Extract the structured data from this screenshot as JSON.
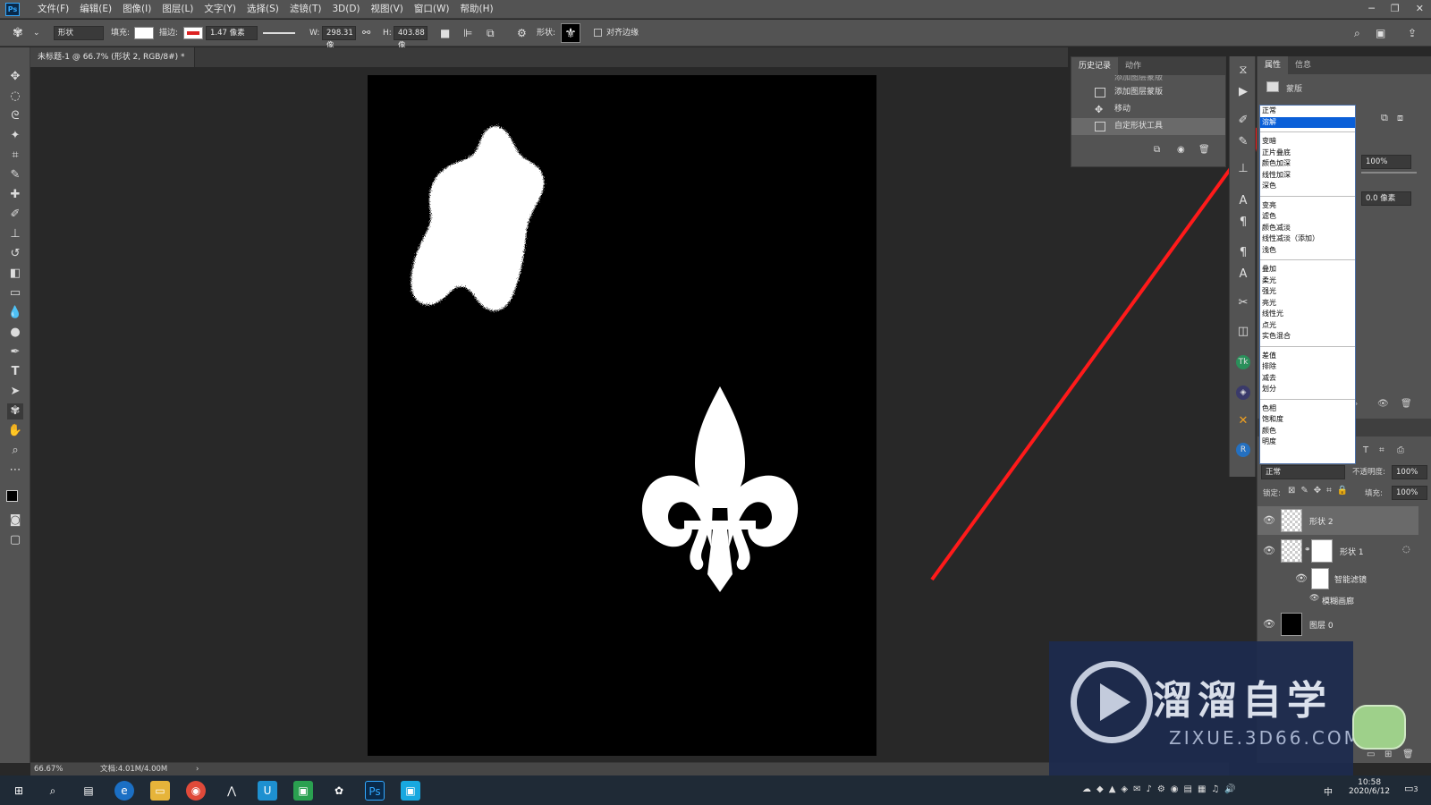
{
  "app": {
    "logo_text": "Ps"
  },
  "menubar": {
    "items": [
      "文件(F)",
      "编辑(E)",
      "图像(I)",
      "图层(L)",
      "文字(Y)",
      "选择(S)",
      "滤镜(T)",
      "3D(D)",
      "视图(V)",
      "窗口(W)",
      "帮助(H)"
    ],
    "minimize": "─",
    "restore": "❐",
    "close": "✕"
  },
  "options": {
    "mode_value": "形状",
    "fill_label": "填充:",
    "stroke_label": "描边:",
    "stroke_width": "1.47 像素",
    "w_label": "W:",
    "w_value": "298.31 像",
    "h_label": "H:",
    "h_value": "403.88 像",
    "shape_label": "形状:",
    "align_edges_label": "对齐边缘"
  },
  "document": {
    "tab_title": "未标题-1 @ 66.7% (形状 2, RGB/8#) *",
    "tab_close": "×",
    "zoom": "66.67%",
    "doc_info": "文档:4.01M/4.00M",
    "status_arrow": "›"
  },
  "history_panel": {
    "tabs": [
      "历史记录",
      "动作"
    ],
    "rows": [
      "添加图层蒙版",
      "添加图层蒙版",
      "移动",
      "自定形状工具"
    ]
  },
  "properties_panel": {
    "tabs": [
      "属性",
      "信息"
    ],
    "mask_label": "蒙版",
    "density": "100%",
    "feather": "0.0 像素"
  },
  "blend_modes": {
    "options": [
      "正常",
      "溶解",
      "",
      "变暗",
      "正片叠底",
      "颜色加深",
      "线性加深",
      "深色",
      "",
      "变亮",
      "滤色",
      "颜色减淡",
      "线性减淡（添加）",
      "浅色",
      "",
      "叠加",
      "柔光",
      "强光",
      "亮光",
      "线性光",
      "点光",
      "实色混合",
      "",
      "差值",
      "排除",
      "减去",
      "划分",
      "",
      "色相",
      "饱和度",
      "颜色",
      "明度"
    ],
    "selected": "溶解"
  },
  "layers_panel": {
    "blend_mode_value": "正常",
    "opacity_label": "不透明度:",
    "opacity_value": "100%",
    "lock_label": "锁定:",
    "fill_label": "填充:",
    "fill_value": "100%",
    "layers": [
      {
        "name": "形状 2"
      },
      {
        "name": "形状 1"
      },
      {
        "name": "智能滤镜"
      },
      {
        "name": "模糊画廊"
      },
      {
        "name": "图层 0"
      }
    ]
  },
  "watermark": {
    "title": "溜溜自学",
    "url": "ZIXUE.3D66.COM"
  },
  "taskbar": {
    "time": "10:58",
    "date": "2020/6/12",
    "ime": "中",
    "notify_count": "3"
  },
  "colors": {
    "accent": "#0a5fd8",
    "arrow": "#ff1a1a",
    "panel": "#535353",
    "canvas_bg": "#282828"
  }
}
